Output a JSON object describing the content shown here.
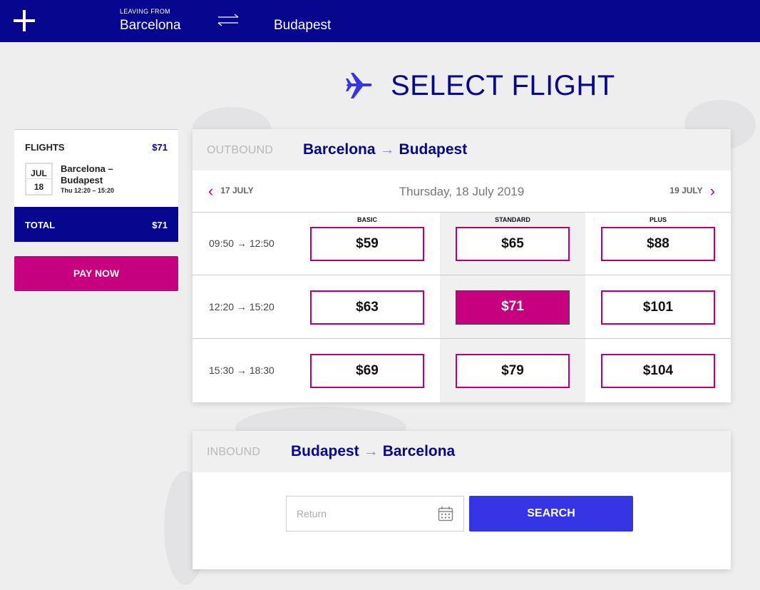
{
  "header": {
    "leaving_label": "LEAVING FROM",
    "origin": "Barcelona",
    "destination": "Budapest"
  },
  "page_title": "SELECT FLIGHT",
  "summary": {
    "flights_label": "FLIGHTS",
    "flights_price": "$71",
    "month": "JUL",
    "day": "18",
    "route": "Barcelona – Budapest",
    "time": "Thu 12:20 – 15:20",
    "total_label": "TOTAL",
    "total_price": "$71",
    "pay_label": "PAY NOW"
  },
  "outbound": {
    "label": "OUTBOUND",
    "from": "Barcelona",
    "arrow": "→",
    "to": "Budapest",
    "prev_date": "17 JULY",
    "current_date": "Thursday, 18 July 2019",
    "next_date": "19 JULY",
    "fare_headers": [
      "BASIC",
      "STANDARD",
      "PLUS"
    ],
    "rows": [
      {
        "time": "09:50 → 12:50",
        "fares": [
          "$59",
          "$65",
          "$88"
        ]
      },
      {
        "time": "12:20 → 15:20",
        "fares": [
          "$63",
          "$71",
          "$101"
        ]
      },
      {
        "time": "15:30 → 18:30",
        "fares": [
          "$69",
          "$79",
          "$104"
        ]
      }
    ]
  },
  "inbound": {
    "label": "INBOUND",
    "from": "Budapest",
    "arrow": "→",
    "to": "Barcelona",
    "return_placeholder": "Return",
    "search_label": "SEARCH"
  },
  "colors": {
    "brand_navy": "#06068f",
    "accent_magenta": "#c6007e",
    "search_blue": "#3535e6"
  }
}
